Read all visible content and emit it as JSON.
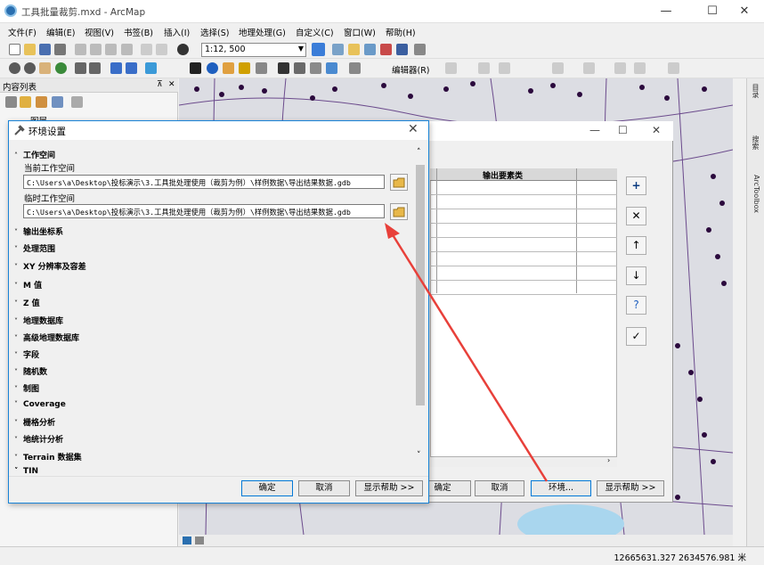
{
  "window": {
    "title": "工具批量裁剪.mxd - ArcMap",
    "min_glyph": "—",
    "max_glyph": "☐",
    "close_glyph": "✕"
  },
  "menu": [
    "文件(F)",
    "编辑(E)",
    "视图(V)",
    "书签(B)",
    "插入(I)",
    "选择(S)",
    "地理处理(G)",
    "自定义(C)",
    "窗口(W)",
    "帮助(H)"
  ],
  "toolbar": {
    "scale": "1:12, 500",
    "editor": "编辑器(R)"
  },
  "toc": {
    "title": "内容列表",
    "pin": "⊼",
    "close": "✕",
    "layers_label": "图层"
  },
  "right_dock": {
    "tabs": [
      "目录",
      "搜索",
      "ArcToolbox"
    ]
  },
  "status": {
    "coords": "12665631.327  2634576.981 米"
  },
  "bg_dialog": {
    "column_header": "输出要素类",
    "ok": "确定",
    "cancel": "取消",
    "env": "环境...",
    "help": "显示帮助 >>",
    "side_buttons": [
      "+",
      "✕",
      "↑",
      "↓",
      "?",
      "✓"
    ]
  },
  "env_dialog": {
    "title": "环境设置",
    "section_workspace": "工作空间",
    "current_ws_label": "当前工作空间",
    "current_ws_value": "C:\\Users\\a\\Desktop\\投标演示\\3.工具批处理使用（裁剪为例）\\样例数据\\导出结果数据.gdb",
    "scratch_ws_label": "临时工作空间",
    "scratch_ws_value": "C:\\Users\\a\\Desktop\\投标演示\\3.工具批处理使用（裁剪为例）\\样例数据\\导出结果数据.gdb",
    "sections": [
      "输出坐标系",
      "处理范围",
      "XY 分辨率及容差",
      "M 值",
      "Z 值",
      "地理数据库",
      "高级地理数据库",
      "字段",
      "随机数",
      "制图",
      "Coverage",
      "栅格分析",
      "地统计分析",
      "Terrain 数据集",
      "TIN"
    ],
    "ok": "确定",
    "cancel": "取消",
    "help": "显示帮助 >>"
  },
  "colors": {
    "accent": "#0078d7",
    "map_bg": "#dcdde3",
    "parcel_line": "#6b4a8c",
    "water": "#a9d6ee",
    "annotation": "#e8403a"
  }
}
